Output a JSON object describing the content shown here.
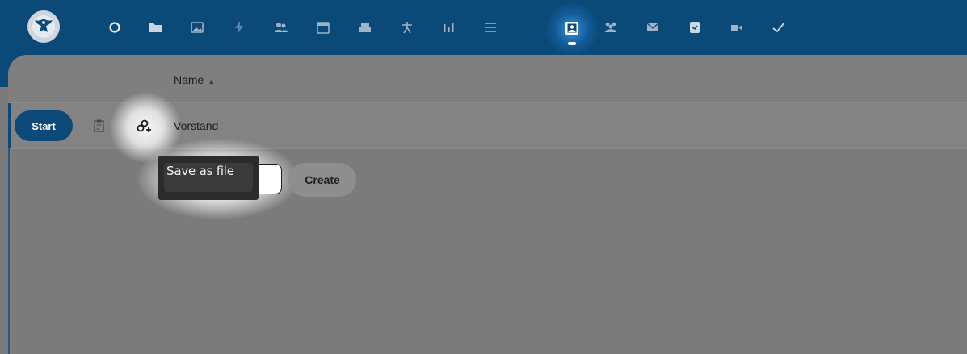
{
  "topbar": {
    "background": "#0b4a78",
    "apps": [
      {
        "id": "dashboard",
        "icon": "circle-icon"
      },
      {
        "id": "files",
        "icon": "folder-icon"
      },
      {
        "id": "photos",
        "icon": "image-icon"
      },
      {
        "id": "activity",
        "icon": "lightning-icon"
      },
      {
        "id": "contacts",
        "icon": "contacts-icon"
      },
      {
        "id": "calendar",
        "icon": "calendar-icon"
      },
      {
        "id": "deck",
        "icon": "inbox-icon"
      },
      {
        "id": "tasks",
        "icon": "star-person-icon"
      },
      {
        "id": "analytics",
        "icon": "bar-chart-icon"
      },
      {
        "id": "lists",
        "icon": "list-icon"
      },
      {
        "id": "active-app",
        "icon": "presentation-icon",
        "active": true
      },
      {
        "id": "circles",
        "icon": "group-icon"
      },
      {
        "id": "mail",
        "icon": "mail-icon"
      },
      {
        "id": "notes",
        "icon": "document-icon"
      },
      {
        "id": "talk",
        "icon": "video-icon"
      },
      {
        "id": "check",
        "icon": "check-icon"
      }
    ]
  },
  "table": {
    "column_name": "Name",
    "sort_indicator": "▲",
    "rows": [
      {
        "start_label": "Start",
        "name": "Vorstand"
      }
    ]
  },
  "new_file": {
    "input_value": "",
    "create_label": "Create"
  },
  "tooltip": {
    "text": "Save as file"
  }
}
